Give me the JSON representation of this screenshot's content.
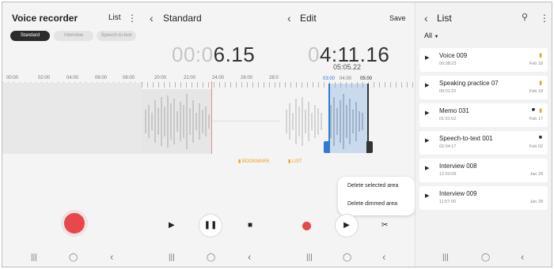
{
  "recorder": {
    "title": "Voice recorder",
    "list_label": "List",
    "more_icon": "⋮",
    "tabs": [
      {
        "label": "Standard",
        "active": true
      },
      {
        "label": "Interview",
        "active": false
      },
      {
        "label": "Speech-to-text",
        "active": false
      }
    ],
    "ruler_ticks": [
      "00:00",
      "02:00",
      "04:00",
      "06:00",
      "08:00"
    ]
  },
  "standard": {
    "title": "Standard",
    "timer_dim": "00:0",
    "timer_main": "6.15",
    "ruler_ticks": [
      "20:00",
      "22:00",
      "24:00",
      "26:00",
      "28:0"
    ],
    "bookmark_label": "BOOKMARK"
  },
  "edit": {
    "title": "Edit",
    "save_label": "Save",
    "timer_dim": "0",
    "timer_main": "4:11.16",
    "sub_timer": "05:05.22",
    "ruler_ticks": [
      "03:00",
      "04:00",
      "05:00"
    ],
    "list_label": "LIST",
    "popup": {
      "delete_selected": "Delete selected area",
      "delete_dimmed": "Delete dimmed area"
    }
  },
  "list": {
    "title": "List",
    "filter": "All",
    "items": [
      {
        "name": "Voice 009",
        "duration": "00:08:23",
        "date": "Feb 18",
        "mark": "bookmark"
      },
      {
        "name": "Speaking practice 07",
        "duration": "00:01:22",
        "date": "Feb 18",
        "mark": "bookmark"
      },
      {
        "name": "Memo 031",
        "duration": "01:01:02",
        "date": "Feb 17",
        "mark": "both"
      },
      {
        "name": "Speech-to-text 001",
        "duration": "02:04:17",
        "date": "Feb 02",
        "mark": "doc"
      },
      {
        "name": "Interview 008",
        "duration": "12:03:09",
        "date": "Jan 28",
        "mark": ""
      },
      {
        "name": "Interview 009",
        "duration": "11:57:00",
        "date": "Jan 28",
        "mark": ""
      }
    ]
  },
  "nav": {
    "recents": "|||",
    "home": "◯",
    "back": "‹"
  },
  "colors": {
    "record": "#e8474b",
    "accent_blue": "#2f7bd1",
    "bookmark": "#e6a21b"
  }
}
